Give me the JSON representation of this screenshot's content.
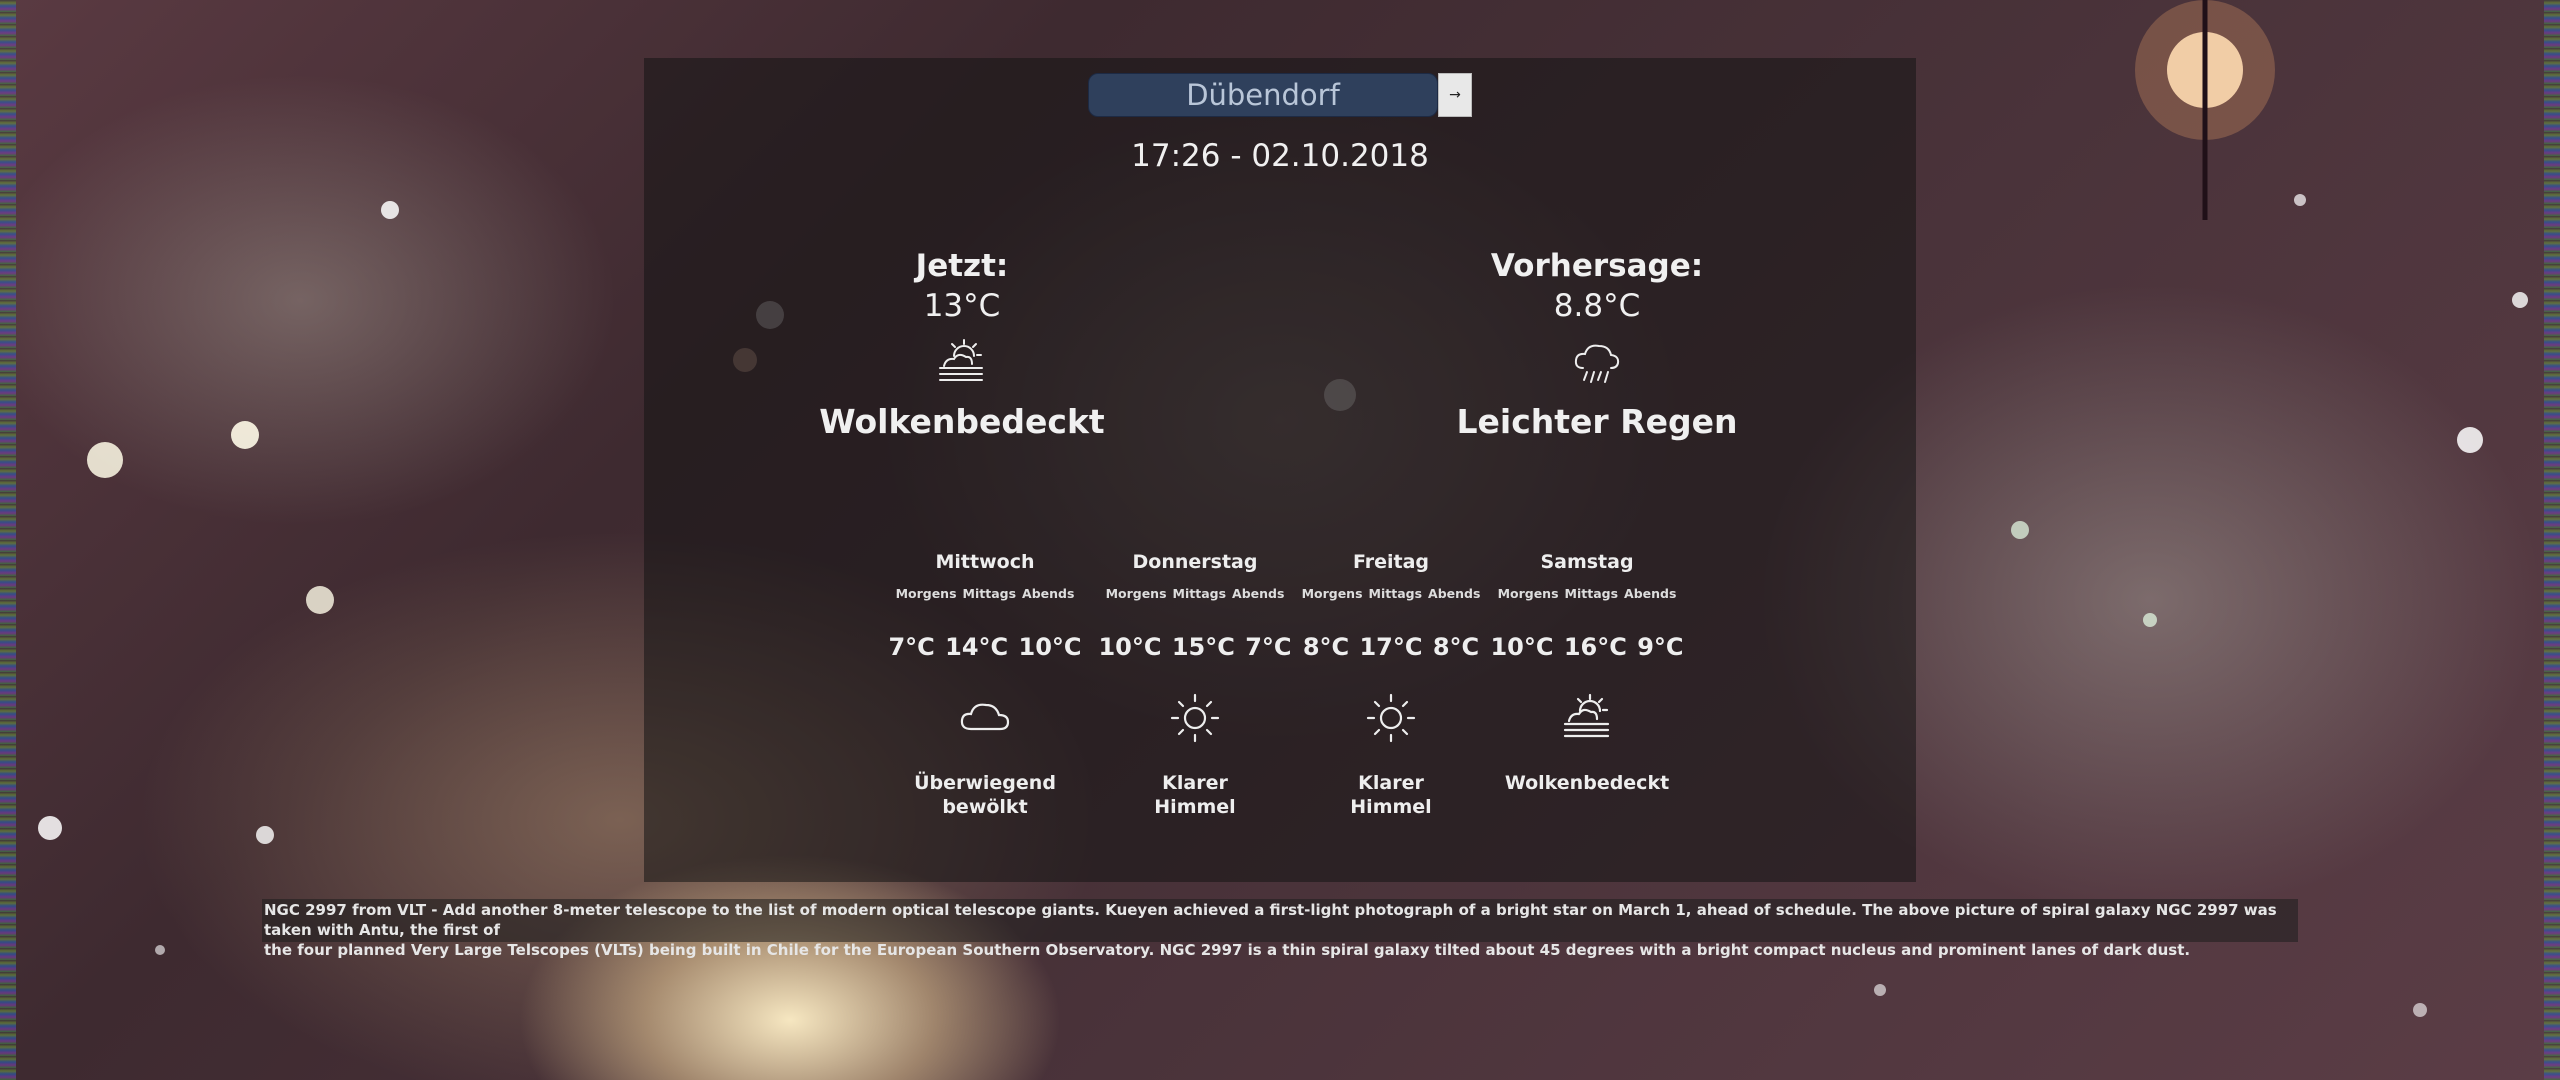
{
  "location": {
    "city_value": "Dübendorf",
    "submit_icon": "arrow-right-icon",
    "submit_label": "→"
  },
  "datetime": "17:26 - 02.10.2018",
  "current": {
    "label": "Jetzt:",
    "temperature": "13°C",
    "condition": "Wolkenbedeckt",
    "icon": "sun-behind-clouds-fog-icon"
  },
  "forecast": {
    "label": "Vorhersage:",
    "temperature": "8.8°C",
    "condition": "Leichter Regen",
    "icon": "rain-cloud-icon"
  },
  "periods": [
    "Morgens",
    "Mittags",
    "Abends"
  ],
  "days": [
    {
      "name": "Mittwoch",
      "temps": [
        "7°C",
        "14°C",
        "10°C"
      ],
      "condition_line1": "Überwiegend",
      "condition_line2": "bewölkt",
      "icon": "cloud-icon"
    },
    {
      "name": "Donnerstag",
      "temps": [
        "10°C",
        "15°C",
        "7°C"
      ],
      "condition_line1": "Klarer",
      "condition_line2": "Himmel",
      "icon": "sun-icon"
    },
    {
      "name": "Freitag",
      "temps": [
        "8°C",
        "17°C",
        "8°C"
      ],
      "condition_line1": "Klarer",
      "condition_line2": "Himmel",
      "icon": "sun-icon"
    },
    {
      "name": "Samstag",
      "temps": [
        "10°C",
        "16°C",
        "9°C"
      ],
      "condition_line1": "Wolkenbedeckt",
      "condition_line2": "",
      "icon": "sun-behind-clouds-fog-icon"
    }
  ],
  "caption": {
    "line1": "NGC 2997 from VLT - Add another 8-meter telescope to the list of modern optical telescope giants. Kueyen achieved a first-light photograph of a bright star on March 1, ahead of schedule. The above picture of spiral galaxy NGC 2997 was taken with Antu, the first of",
    "line2": "the four planned Very Large Telscopes (VLTs) being built in Chile for the European Southern Observatory. NGC 2997 is a thin spiral galaxy tilted about 45 degrees with a bright compact nucleus and prominent lanes of dark dust."
  }
}
